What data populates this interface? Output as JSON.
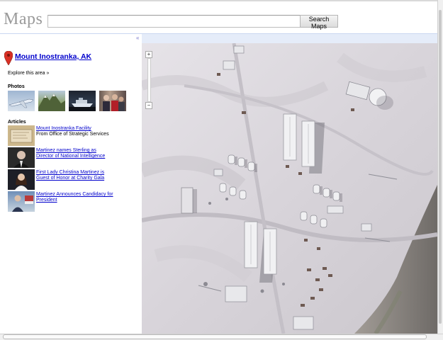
{
  "header": {
    "logo": "Maps",
    "search_value": "",
    "search_button": "Search Maps"
  },
  "panel": {
    "collapse_glyph": "«",
    "place_title": "Mount Inostranka, AK",
    "explore_link": "Explore this area »",
    "photos_title": "Photos",
    "articles_title": "Articles",
    "articles": [
      {
        "title": "Mount Inostranka Facility",
        "source": "From Office of Strategic Services"
      },
      {
        "title": "Martinez names Sterling as Director of National Intelligence"
      },
      {
        "title": "First Lady Christina Martinez is Guest of Honor at Charity Gala"
      },
      {
        "title": "Martinez Announces Candidacy for President"
      }
    ]
  },
  "map": {
    "zoom_in": "+",
    "zoom_out": "−"
  },
  "colors": {
    "link": "#0000cc",
    "blue_bar": "#e5ecf9",
    "pin": "#d93025"
  },
  "icons": {
    "pin": "map-pin-icon",
    "collapse": "double-chevron-left-icon"
  }
}
